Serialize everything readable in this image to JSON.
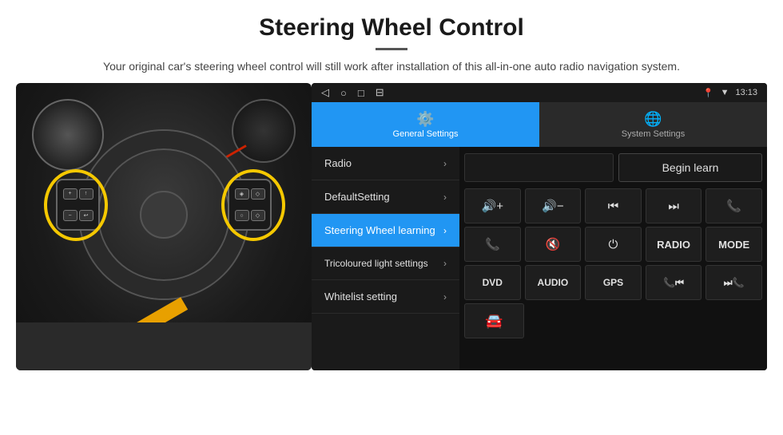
{
  "header": {
    "title": "Steering Wheel Control",
    "divider": "—",
    "subtitle": "Your original car's steering wheel control will still work after installation of this all-in-one auto radio navigation system."
  },
  "status_bar": {
    "nav_icons": [
      "◁",
      "○",
      "□",
      "⊟"
    ],
    "time": "13:13",
    "signal": "▼"
  },
  "tabs": {
    "general": {
      "label": "General Settings",
      "icon": "⚙"
    },
    "system": {
      "label": "System Settings",
      "icon": "🌐"
    }
  },
  "menu": {
    "items": [
      {
        "label": "Radio",
        "active": false
      },
      {
        "label": "DefaultSetting",
        "active": false
      },
      {
        "label": "Steering Wheel learning",
        "active": true
      },
      {
        "label": "Tricoloured light settings",
        "active": false
      },
      {
        "label": "Whitelist setting",
        "active": false
      }
    ]
  },
  "controls": {
    "begin_learn": "Begin learn",
    "row1": [
      "🔊+",
      "🔊−",
      "⏮",
      "⏭",
      "📞"
    ],
    "row2": [
      "📞",
      "🔇",
      "⏻",
      "RADIO",
      "MODE"
    ],
    "row3": [
      "DVD",
      "AUDIO",
      "GPS",
      "📞⏮",
      "⏭📞"
    ],
    "row4_icon": "🚗"
  }
}
